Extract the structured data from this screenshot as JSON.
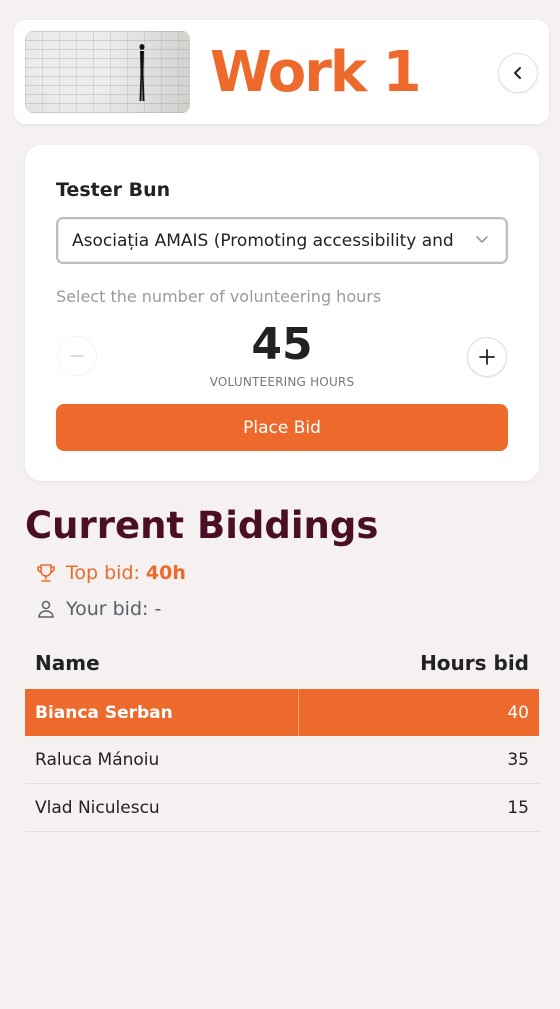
{
  "header": {
    "title": "Work 1",
    "thumbnail": "artwork-thumbnail",
    "back_icon": "chevron-left-icon"
  },
  "bid_form": {
    "user_name": "Tester Bun",
    "organization_selected": "Asociația AMAIS (Promoting accessibility and inclusion)",
    "organization_chevron_icon": "chevron-down-icon",
    "hours_prompt": "Select the number of volunteering hours",
    "hours_value": "45",
    "hours_unit": "VOLUNTEERING HOURS",
    "minus_label": "–",
    "plus_label": "+",
    "place_bid_label": "Place Bid"
  },
  "biddings": {
    "title": "Current Biddings",
    "top_bid_label": "Top bid:",
    "top_bid_value": "40h",
    "top_bid_icon": "trophy-icon",
    "your_bid_label": "Your bid: -",
    "your_bid_icon": "user-icon",
    "columns": [
      "Name",
      "Hours bid"
    ],
    "rows": [
      {
        "name": "Bianca Serban",
        "hours": "40"
      },
      {
        "name": "Raluca Mánoiu",
        "hours": "35"
      },
      {
        "name": "Vlad Niculescu",
        "hours": "15"
      }
    ]
  },
  "colors": {
    "accent": "#ee6a2c",
    "heading": "#4a0f26",
    "background": "#f5f1f0"
  }
}
